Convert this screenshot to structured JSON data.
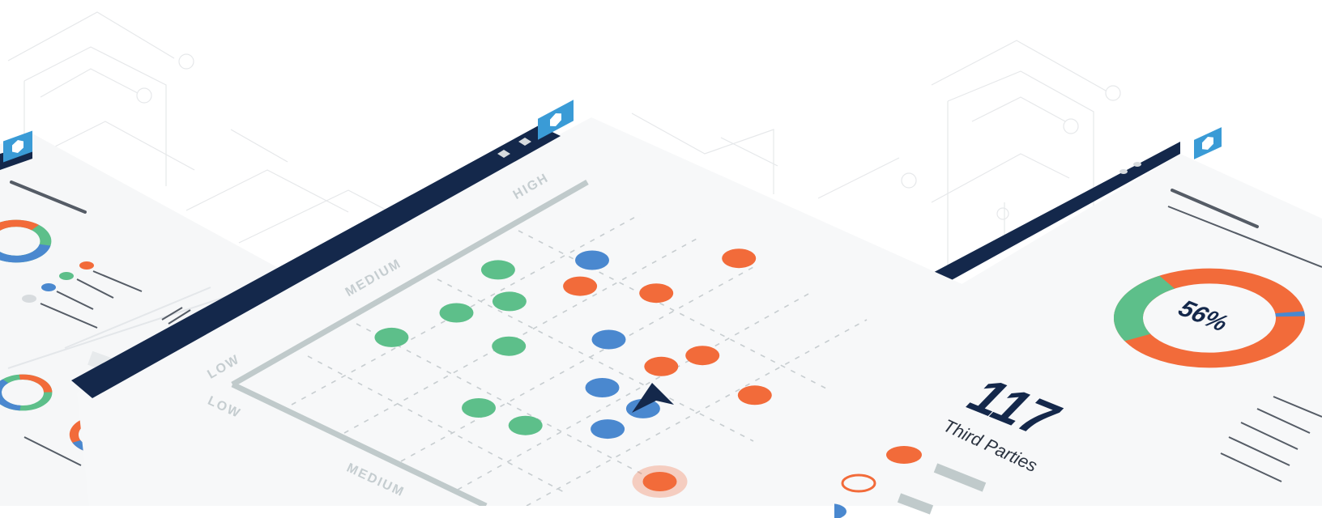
{
  "colors": {
    "navy": "#14284b",
    "blue": "#4a88cf",
    "orange": "#f26b3a",
    "green": "#5dbf8a",
    "logo": "#3a9bd6",
    "axis": "#c5cdd0"
  },
  "icons": {
    "logo": "hexagon-gear-icon",
    "cursor": "pointer-arrow-icon"
  },
  "risk_matrix": {
    "y_labels": [
      "LOW",
      "MEDIUM",
      "HIGH"
    ],
    "x_labels": [
      "LOW",
      "MEDIUM"
    ]
  },
  "stat": {
    "value": "117",
    "label": "Third Parties"
  },
  "donut": {
    "percent_text": "56%",
    "percent": 56
  },
  "chart_data": {
    "type": "scatter",
    "title": "",
    "xlabel": "",
    "ylabel": "",
    "y_categories": [
      "LOW",
      "MEDIUM",
      "HIGH"
    ],
    "x_categories": [
      "LOW",
      "MEDIUM"
    ],
    "series": [
      {
        "color": "#f26b3a",
        "points": [
          [
            2.6,
            6.0
          ],
          [
            2.4,
            4.8
          ],
          [
            1.6,
            4.3
          ],
          [
            3.8,
            4.2
          ],
          [
            3.6,
            3.7
          ],
          [
            4.9,
            4.0
          ],
          [
            5.4,
            1.9
          ]
        ]
      },
      {
        "color": "#4a88cf",
        "points": [
          [
            1.3,
            4.8
          ],
          [
            2.7,
            3.7
          ],
          [
            3.4,
            2.9
          ],
          [
            4.1,
            2.9
          ],
          [
            4.1,
            2.3
          ],
          [
            5.9,
            1.3
          ]
        ]
      },
      {
        "color": "#5dbf8a",
        "points": [
          [
            0.6,
            3.9
          ],
          [
            1.2,
            3.5
          ],
          [
            0.9,
            2.9
          ],
          [
            1.9,
            2.8
          ],
          [
            0.7,
            2.0
          ],
          [
            2.6,
            1.6
          ],
          [
            3.3,
            1.7
          ]
        ]
      }
    ]
  }
}
